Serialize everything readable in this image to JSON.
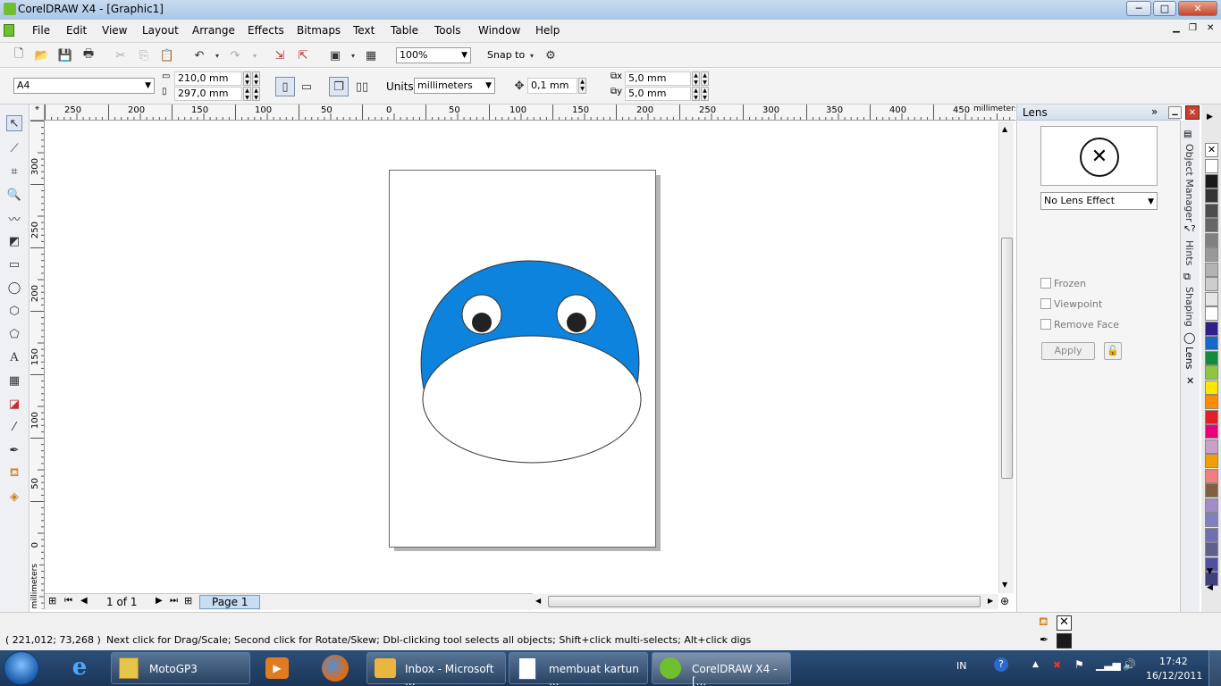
{
  "window": {
    "title": "CorelDRAW X4 - [Graphic1]",
    "minimize": "─",
    "maximize": "□",
    "close": "✕"
  },
  "menu": [
    "File",
    "Edit",
    "View",
    "Layout",
    "Arrange",
    "Effects",
    "Bitmaps",
    "Text",
    "Table",
    "Tools",
    "Window",
    "Help"
  ],
  "standard_toolbar": {
    "zoom": "100%",
    "snap_to": "Snap to"
  },
  "property_bar": {
    "page_size": "A4",
    "width": "210,0 mm",
    "height": "297,0 mm",
    "units_label": "Units:",
    "units": "millimeters",
    "nudge": "0,1 mm",
    "dup_x": "5,0 mm",
    "dup_y": "5,0 mm"
  },
  "rulers": {
    "h_ticks": [
      "250",
      "200",
      "150",
      "100",
      "50",
      "0",
      "50",
      "100",
      "150",
      "200",
      "250",
      "300",
      "350",
      "400",
      "450"
    ],
    "h_unit": "millimeters",
    "v_ticks": [
      "300",
      "250",
      "200",
      "150",
      "100",
      "50",
      "0"
    ],
    "v_unit": "millimeters"
  },
  "page_nav": {
    "count": "1 of 1",
    "tab": "Page 1"
  },
  "docker": {
    "title": "Lens",
    "lens_effect": "No Lens Effect",
    "options": [
      "Frozen",
      "Viewpoint",
      "Remove Face"
    ],
    "apply": "Apply",
    "tabs": [
      "Object Manager",
      "Hints",
      "Shaping",
      "Lens"
    ]
  },
  "palette": [
    "#ffffff",
    "#1a1a1a",
    "#333333",
    "#4d4d4d",
    "#666666",
    "#808080",
    "#999999",
    "#b3b3b3",
    "#cccccc",
    "#e6e6e6",
    "#ffffff",
    "#2e1f8a",
    "#1769c9",
    "#138a3c",
    "#8dc63f",
    "#ffe600",
    "#ff8c00",
    "#e31e24",
    "#e6007e",
    "#c8a0c8",
    "#f0a000",
    "#f08080",
    "#806040",
    "#a08cc8",
    "#8080c0",
    "#7070b0",
    "#606090",
    "#5050a0",
    "#404080"
  ],
  "status": {
    "coords": "( 221,012; 73,268 )",
    "hint": "Next click for Drag/Scale; Second click for Rotate/Skew; Dbl-clicking tool selects all objects; Shift+click multi-selects; Alt+click digs"
  },
  "taskbar": {
    "tasks": [
      "MotoGP3",
      "Inbox - Microsoft ...",
      "membuat kartun ...",
      "CorelDRAW X4 - [..."
    ],
    "lang": "IN",
    "time": "17:42",
    "date": "16/12/2011"
  },
  "colors": {
    "blue_shape": "#0d83dd",
    "accent": "#c9dcef"
  }
}
